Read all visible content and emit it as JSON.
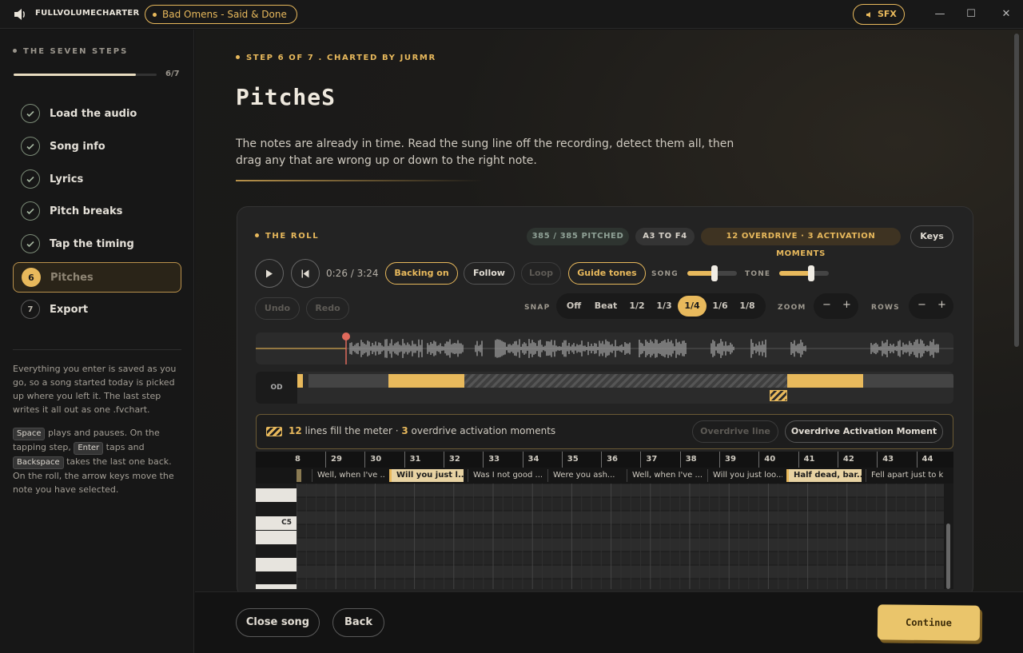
{
  "app": {
    "brand": "FULLVOLUMECHARTER",
    "song_pill": "Bad Omens - Said & Done",
    "sfx_label": "SFX",
    "window_controls": [
      "—",
      "☐",
      "✕"
    ]
  },
  "sidebar": {
    "heading": "THE SEVEN STEPS",
    "progress_text": "6/7",
    "progress_fraction": 0.857,
    "steps": [
      {
        "label": "Load the audio",
        "state": "done"
      },
      {
        "label": "Song info",
        "state": "done"
      },
      {
        "label": "Lyrics",
        "state": "done"
      },
      {
        "label": "Pitch breaks",
        "state": "done"
      },
      {
        "label": "Tap the timing",
        "state": "done"
      },
      {
        "label": "Pitches",
        "state": "active",
        "number": "6"
      },
      {
        "label": "Export",
        "state": "pending",
        "number": "7"
      }
    ],
    "note1": "Everything you enter is saved as you go, so a song started today is picked up where you left it. The last step writes it all out as one .fvchart.",
    "note2": {
      "key_space": "Space",
      "t1": " plays and pauses. On the tapping step, ",
      "key_enter": "Enter",
      "t2": " taps and ",
      "key_backspace": "Backspace",
      "t3": " takes the last one back. On the roll, the arrow keys move the note you have selected."
    }
  },
  "main": {
    "step_label": "STEP 6 OF 7 . CHARTED BY JURMR",
    "title": "PitcheS",
    "description": "The notes are already in time. Read the sung line off the recording, detect them all, then drag any that are wrong up or down to the right note."
  },
  "roll": {
    "title": "THE ROLL",
    "badge_pitched": "385 / 385 PITCHED",
    "badge_range": "A3 TO F4",
    "badge_overdrive": "12 OVERDRIVE · 3 ACTIVATION MOMENTS",
    "keys_button": "Keys",
    "time_display": "0:26 / 3:24",
    "backing_button": "Backing on",
    "follow_button": "Follow",
    "loop_button": "Loop",
    "guide_button": "Guide tones",
    "song_label": "SONG",
    "tone_label": "TONE",
    "song_volume": 0.55,
    "tone_volume": 0.65,
    "undo_button": "Undo",
    "redo_button": "Redo",
    "snap_label": "SNAP",
    "snap_options": [
      "Off",
      "Beat",
      "1/2",
      "1/3",
      "1/4",
      "1/6",
      "1/8"
    ],
    "snap_selected": "1/4",
    "zoom_label": "ZOOM",
    "rows_label": "ROWS",
    "minus": "−",
    "plus": "+",
    "od_label": "OD",
    "meter_count_lines": "12",
    "meter_text_1": " lines fill the meter · ",
    "meter_count_moments": "3",
    "meter_text_2": " overdrive activation moments",
    "overdrive_line_button": "Overdrive line",
    "activation_button": "Overdrive Activation Moment",
    "ruler_start": "8",
    "measures": [
      "29",
      "30",
      "31",
      "32",
      "33",
      "34",
      "35",
      "36",
      "37",
      "38",
      "39",
      "40",
      "41",
      "42",
      "43",
      "44"
    ],
    "lyrics": [
      {
        "text": "Well, when I've ...",
        "hl": false
      },
      {
        "text": "Will you just l...",
        "hl": true
      },
      {
        "text": "Was I not good ...",
        "hl": false
      },
      {
        "text": "Were you ash...",
        "hl": false
      },
      {
        "text": "Well, when I've ...",
        "hl": false
      },
      {
        "text": "Will you just loo...",
        "hl": false
      },
      {
        "text": "Half dead, bar...",
        "hl": true
      },
      {
        "text": "Fell apart just to k",
        "hl": false
      }
    ],
    "key_label": "C5"
  },
  "footer": {
    "close_song": "Close song",
    "back": "Back",
    "continue": "Continue"
  },
  "colors": {
    "accent": "#e8b95c",
    "check": "#7c8c78"
  }
}
